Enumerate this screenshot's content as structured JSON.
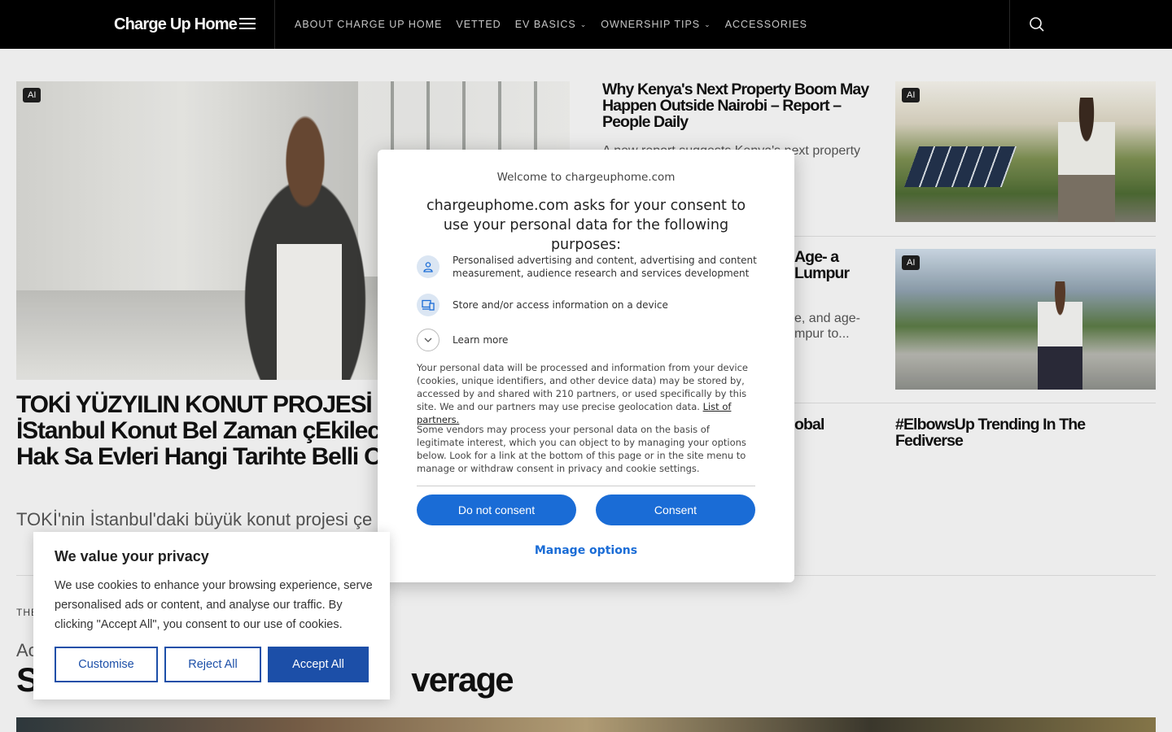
{
  "header": {
    "brand": "Charge Up Home",
    "nav": [
      {
        "label": "ABOUT CHARGE UP HOME"
      },
      {
        "label": "VETTED"
      },
      {
        "label": "EV BASICS"
      },
      {
        "label": "OWNERSHIP TIPS"
      },
      {
        "label": "ACCESSORIES"
      }
    ]
  },
  "hero": {
    "badge": "AI",
    "title": "TOKİ YÜZYILIN KONUT PROJESİ  ÇEKİLİŞİ  TOKİ İStanbul Konut Bel Zaman çEkilecek? TOKİ'den Hak Sa Evleri Hangi Tarihte Belli Olacak",
    "excerpt": "TOKİ'nin İstanbul'daki büyük konut projesi çe"
  },
  "side_posts": [
    {
      "badge": "AI",
      "title": "Why Kenya's Next Property Boom May Happen Outside Nairobi – Report – People Daily",
      "excerpt": "A new report suggests Kenya's next property e..."
    },
    {
      "badge": "AI",
      "title": "Age- a Lumpur",
      "excerpt": "e, and age- mpur to..."
    },
    {
      "title": "obal"
    },
    {
      "title": "#ElbowsUp Trending In The Fediverse"
    }
  ],
  "section": {
    "category": "THE",
    "subtitle": "Ac",
    "title_start": "S",
    "title_end": "verage"
  },
  "consent": {
    "welcome": "Welcome to chargeuphome.com",
    "heading": "chargeuphome.com asks for your consent to use your personal data for the following purposes:",
    "purpose_1": "Personalised advertising and content, advertising and content measurement, audience research and services development",
    "purpose_2": "Store and/or access information on a device",
    "learn_more": "Learn more",
    "paragraph_1": "Your personal data will be processed and information from your device (cookies, unique identifiers, and other device data) may be stored by, accessed by and shared with 210 partners, or used specifically by this site. We and our partners may use precise geolocation data.",
    "partners_link": "List of partners.",
    "paragraph_2": "Some vendors may process your personal data on the basis of legitimate interest, which you can object to by managing your options below. Look for a link at the bottom of this page or in the site menu to manage or withdraw consent in privacy and cookie settings.",
    "do_not_consent": "Do not consent",
    "consent": "Consent",
    "manage_options": "Manage options",
    "accent_color": "#1a6cd6"
  },
  "cookie_banner": {
    "title": "We value your privacy",
    "body": "We use cookies to enhance your browsing experience, serve personalised ads or content, and analyse our traffic. By clicking \"Accept All\", you consent to our use of cookies.",
    "customise": "Customise",
    "reject_all": "Reject All",
    "accept_all": "Accept All",
    "accent_color": "#1c4fa8"
  }
}
